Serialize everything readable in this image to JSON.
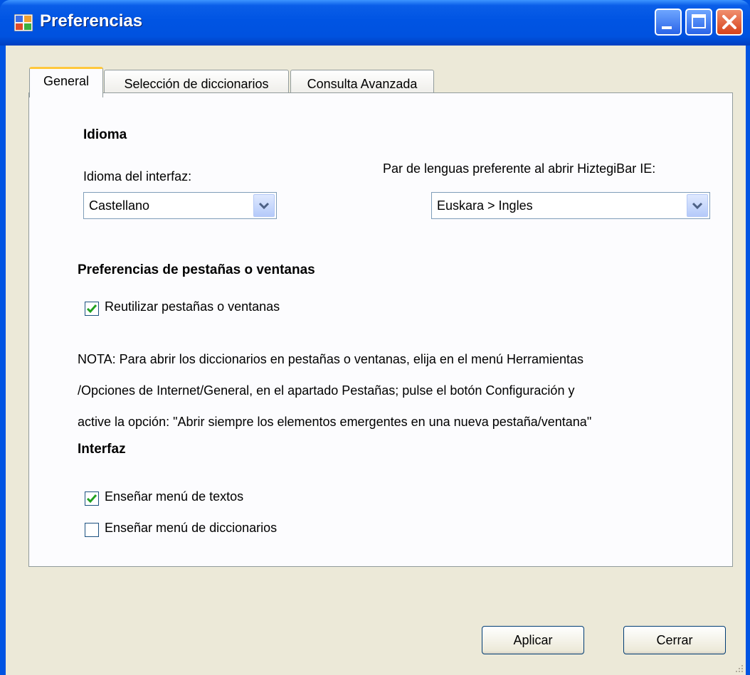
{
  "window": {
    "title": "Preferencias",
    "controls": {
      "minimize": "minimize-icon",
      "maximize": "maximize-icon",
      "close": "close-icon"
    }
  },
  "tabs": [
    {
      "label": "General",
      "active": true
    },
    {
      "label": "Selección de diccionarios",
      "active": false
    },
    {
      "label": "Consulta Avanzada",
      "active": false
    }
  ],
  "general": {
    "idioma_section": "Idioma",
    "interface_language_label": "Idioma del interfaz:",
    "interface_language_value": "Castellano",
    "language_pair_label": "Par de lenguas preferente al abrir HiztegiBar IE:",
    "language_pair_value": "Euskara > Ingles",
    "tabs_section": "Preferencias de pestañas o ventanas",
    "reuse_tabs_label": "Reutilizar pestañas o ventanas",
    "reuse_tabs_checked": true,
    "note_line1": "NOTA: Para abrir los diccionarios en pestañas o ventanas, elija en el menú Herramientas",
    "note_line2": "/Opciones de Internet/General, en el apartado Pestañas; pulse el botón Configuración y",
    "note_line3": "active la opción: \"Abrir siempre los elementos emergentes en una nueva pestaña/ventana\"",
    "interface_section": "Interfaz",
    "show_texts_menu_label": "Enseñar menú de textos",
    "show_texts_menu_checked": true,
    "show_dict_menu_label": "Enseñar menú de diccionarios",
    "show_dict_menu_checked": false
  },
  "buttons": {
    "apply": "Aplicar",
    "close": "Cerrar"
  },
  "colors": {
    "titlebar": "#0054e3",
    "client": "#ece9d8",
    "check": "#21a121"
  }
}
